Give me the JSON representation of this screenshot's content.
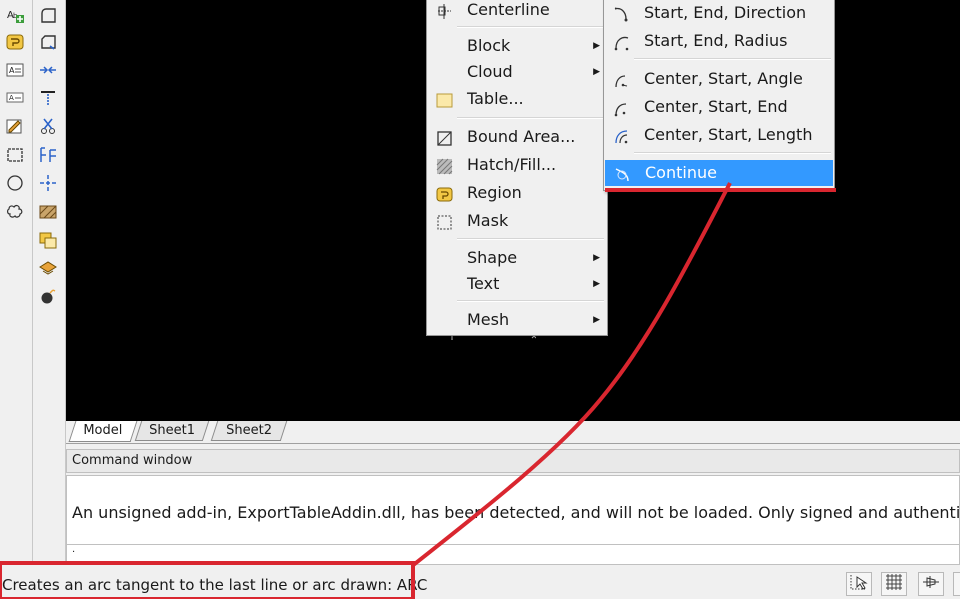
{
  "left_toolbar": {
    "icons": [
      "annotation-add-icon",
      "region-icon",
      "textbox-icon",
      "text-icon",
      "revision-cloud-icon",
      "rectangle-select-icon",
      "circle-icon",
      "freeform-shape-icon"
    ]
  },
  "modify_toolbar": {
    "icons": [
      "fillet-icon",
      "chamfer-icon",
      "join-icon",
      "extend-icon",
      "trim-icon",
      "array-icon",
      "center-mark-icon",
      "hatch-icon",
      "copy-layer-icon",
      "flatten-icon",
      "explode-icon"
    ]
  },
  "draw_menu": {
    "items": [
      {
        "label": "Centerline",
        "has_submenu": false,
        "icon": "centerline-icon"
      },
      {
        "label": "Block",
        "has_submenu": true
      },
      {
        "label": "Cloud",
        "has_submenu": true
      },
      {
        "label": "Table...",
        "has_submenu": false,
        "icon": "table-icon"
      },
      {
        "label": "Bound Area...",
        "has_submenu": false,
        "icon": "bound-area-icon"
      },
      {
        "label": "Hatch/Fill...",
        "has_submenu": false,
        "icon": "hatch-icon"
      },
      {
        "label": "Region",
        "has_submenu": false,
        "icon": "region-icon"
      },
      {
        "label": "Mask",
        "has_submenu": false,
        "icon": "mask-icon"
      },
      {
        "label": "Shape",
        "has_submenu": true
      },
      {
        "label": "Text",
        "has_submenu": true
      },
      {
        "label": "Mesh",
        "has_submenu": true
      }
    ]
  },
  "arc_submenu": {
    "items": [
      {
        "label": "Start, End, Direction",
        "icon": "arc-start-end-direction-icon"
      },
      {
        "label": "Start, End, Radius",
        "icon": "arc-start-end-radius-icon"
      },
      {
        "label": "Center, Start, Angle",
        "icon": "arc-center-start-angle-icon"
      },
      {
        "label": "Center, Start, End",
        "icon": "arc-center-start-end-icon"
      },
      {
        "label": "Center, Start, Length",
        "icon": "arc-center-start-length-icon"
      },
      {
        "label": "Continue",
        "icon": "arc-continue-icon",
        "highlighted": true
      }
    ]
  },
  "sheet_tabs": [
    "Model",
    "Sheet1",
    "Sheet2"
  ],
  "active_tab": "Model",
  "command_window": {
    "title": "Command window",
    "message": "An unsigned add-in, ExportTableAddin.dll, has been detected, and will not be loaded. Only signed and authenticated add-ins are loaded.",
    "prompt": "."
  },
  "status_bar": {
    "text": "Creates an arc tangent to the last line or arc drawn:  ARC",
    "buttons": [
      "snap-icon",
      "grid-icon",
      "ortho-icon"
    ]
  },
  "colors": {
    "canvas": "#000000",
    "highlight": "#3399ff",
    "annotation": "#d9262f"
  }
}
